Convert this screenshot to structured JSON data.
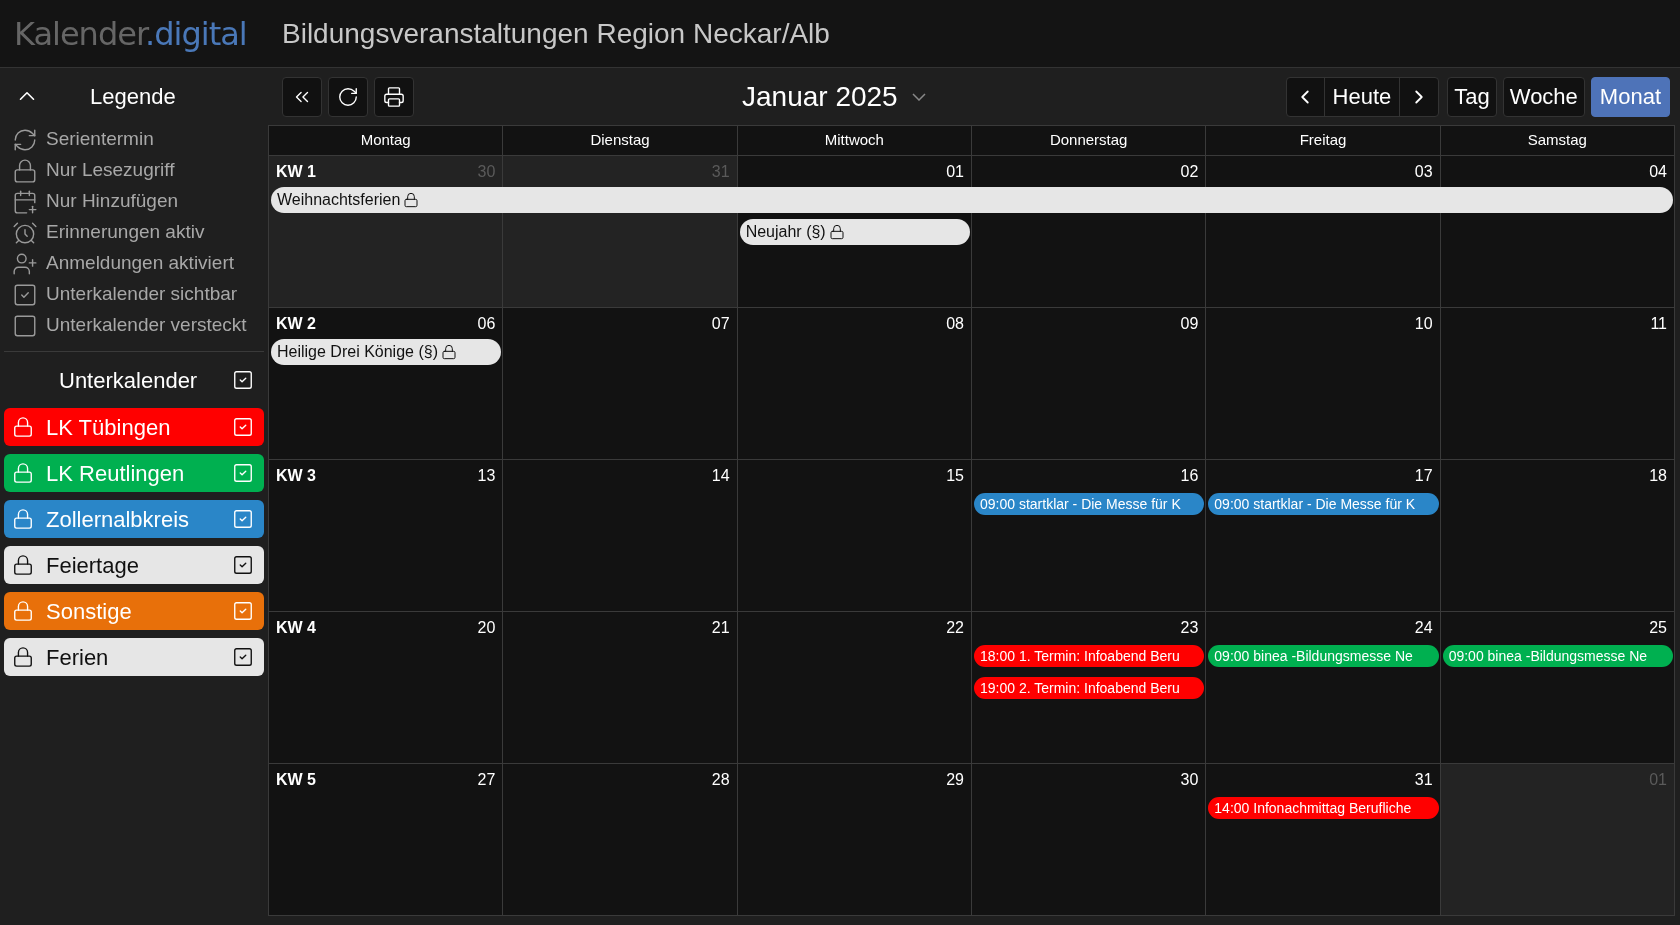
{
  "logo": {
    "text": "Kalender",
    "accent": ".digital"
  },
  "title": "Bildungsveranstaltungen Region Neckar/Alb",
  "legend": {
    "title": "Legende",
    "expanded": true,
    "items": [
      {
        "kind": "recurring",
        "label": "Serientermin"
      },
      {
        "kind": "lock",
        "label": "Nur Lesezugriff"
      },
      {
        "kind": "add",
        "label": "Nur Hinzufügen"
      },
      {
        "kind": "alarm",
        "label": "Erinnerungen aktiv"
      },
      {
        "kind": "signup",
        "label": "Anmeldungen aktiviert"
      },
      {
        "kind": "checked",
        "label": "Unterkalender sichtbar"
      },
      {
        "kind": "unchecked",
        "label": "Unterkalender versteckt"
      }
    ]
  },
  "subcalendars": {
    "title": "Unterkalender",
    "checked": true,
    "items": [
      {
        "label": "LK Tübingen",
        "color": "#ff0000",
        "checked": true,
        "locked": true
      },
      {
        "label": "LK Reutlingen",
        "color": "#00b050",
        "checked": true,
        "locked": true
      },
      {
        "label": "Zollernalbkreis",
        "color": "#2a86c8",
        "checked": true,
        "locked": true
      },
      {
        "label": "Feiertage",
        "color": "#e6e6e6",
        "checked": true,
        "locked": true
      },
      {
        "label": "Sonstige",
        "color": "#e8700a",
        "checked": true,
        "locked": true
      },
      {
        "label": "Ferien",
        "color": "#e6e6e6",
        "checked": true,
        "locked": true
      }
    ]
  },
  "toolbar": {
    "month": "Januar 2025",
    "today": "Heute",
    "views": [
      {
        "label": "Tag",
        "selected": false
      },
      {
        "label": "Woche",
        "selected": false
      },
      {
        "label": "Monat",
        "selected": true
      }
    ]
  },
  "weekdays": [
    "Montag",
    "Dienstag",
    "Mittwoch",
    "Donnerstag",
    "Freitag",
    "Samstag"
  ],
  "weeks": [
    {
      "label": "KW 1",
      "days": [
        {
          "date": "30",
          "outside": true,
          "events": [
            {
              "text": "Weihnachtsferien",
              "color": "#e6e6e6",
              "locked": true,
              "spans_week": true
            }
          ]
        },
        {
          "date": "31",
          "outside": true
        },
        {
          "date": "01",
          "outside": false,
          "events": [
            {
              "text": "Neujahr (§)",
              "color": "#e6e6e6",
              "locked": true
            }
          ]
        },
        {
          "date": "02",
          "outside": false
        },
        {
          "date": "03",
          "outside": false
        },
        {
          "date": "04",
          "outside": false
        }
      ]
    },
    {
      "label": "KW 2",
      "days": [
        {
          "date": "06",
          "outside": false,
          "events": [
            {
              "text": "Heilige Drei Könige (§)",
              "color": "#e6e6e6",
              "locked": true
            }
          ]
        },
        {
          "date": "07",
          "outside": false
        },
        {
          "date": "08",
          "outside": false
        },
        {
          "date": "09",
          "outside": false
        },
        {
          "date": "10",
          "outside": false
        },
        {
          "date": "11",
          "outside": false
        }
      ]
    },
    {
      "label": "KW 3",
      "days": [
        {
          "date": "13",
          "outside": false
        },
        {
          "date": "14",
          "outside": false
        },
        {
          "date": "15",
          "outside": false
        },
        {
          "date": "16",
          "outside": false,
          "events": [
            {
              "text": "09:00 startklar - Die Messe für K",
              "color": "#2a86c8"
            }
          ]
        },
        {
          "date": "17",
          "outside": false,
          "events": [
            {
              "text": "09:00 startklar - Die Messe für K",
              "color": "#2a86c8"
            }
          ]
        },
        {
          "date": "18",
          "outside": false
        }
      ]
    },
    {
      "label": "KW 4",
      "days": [
        {
          "date": "20",
          "outside": false
        },
        {
          "date": "21",
          "outside": false
        },
        {
          "date": "22",
          "outside": false
        },
        {
          "date": "23",
          "outside": false,
          "events": [
            {
              "text": "18:00 1. Termin: Infoabend Beru",
              "color": "#ff0000"
            },
            {
              "text": "19:00 2. Termin: Infoabend Beru",
              "color": "#ff0000"
            }
          ]
        },
        {
          "date": "24",
          "outside": false,
          "events": [
            {
              "text": "09:00 binea -Bildungsmesse Ne",
              "color": "#00b050"
            }
          ]
        },
        {
          "date": "25",
          "outside": false,
          "events": [
            {
              "text": "09:00 binea -Bildungsmesse Ne",
              "color": "#00b050"
            }
          ]
        }
      ]
    },
    {
      "label": "KW 5",
      "days": [
        {
          "date": "27",
          "outside": false
        },
        {
          "date": "28",
          "outside": false
        },
        {
          "date": "29",
          "outside": false
        },
        {
          "date": "30",
          "outside": false
        },
        {
          "date": "31",
          "outside": false,
          "events": [
            {
              "text": "14:00 Infonachmittag Berufliche",
              "color": "#ff0000"
            }
          ]
        },
        {
          "date": "01",
          "outside": true
        }
      ]
    }
  ]
}
